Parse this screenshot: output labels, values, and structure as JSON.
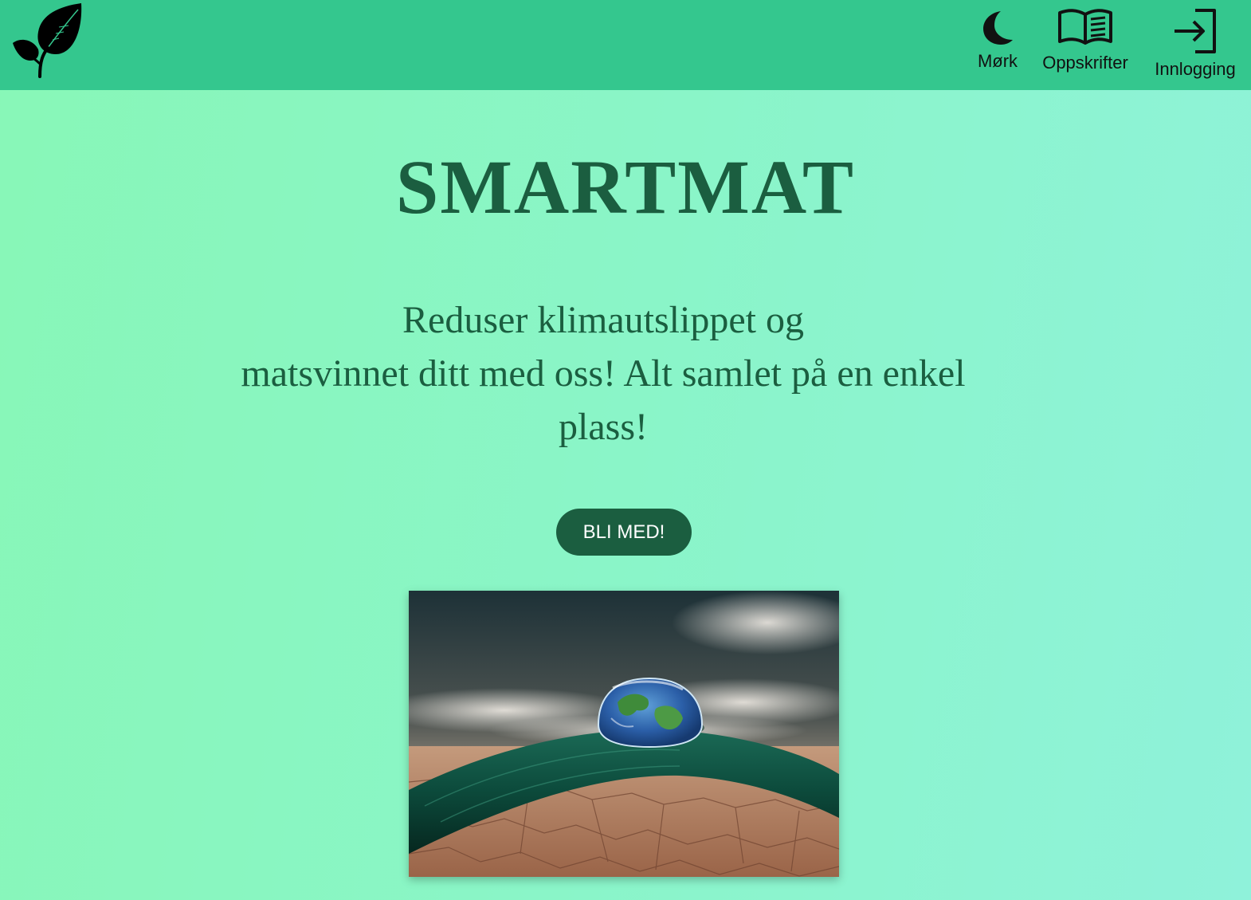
{
  "header": {
    "logo_icon": "leaf-icon",
    "nav": [
      {
        "icon": "moon-icon",
        "label": "Mørk"
      },
      {
        "icon": "book-icon",
        "label": "Oppskrifter"
      },
      {
        "icon": "login-icon",
        "label": "Innlogging"
      }
    ]
  },
  "main": {
    "title": "SMARTMAT",
    "tagline_lines": [
      "Reduser klimautslippet og",
      "matsvinnet ditt med oss! Alt samlet på en enkel",
      "plass!"
    ],
    "cta_label": "BLI MED!"
  },
  "colors": {
    "header_bg": "#34c78e",
    "accent": "#1b5e40",
    "page_gradient_start": "#88f7b7",
    "page_gradient_end": "#8ff2da"
  }
}
